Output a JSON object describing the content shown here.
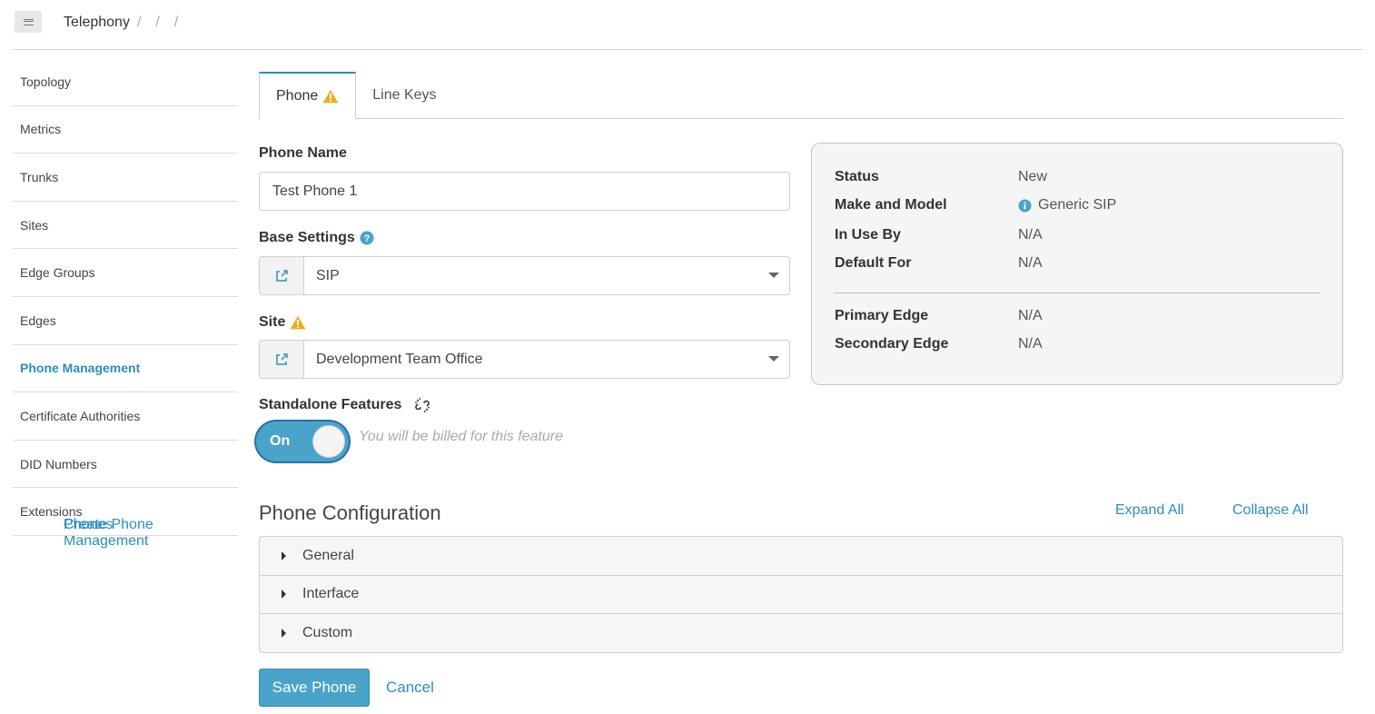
{
  "breadcrumb": {
    "items": [
      "Telephony",
      "Phone Management",
      "Phones",
      "Create Phone"
    ],
    "separator": "/"
  },
  "sidebar": {
    "items": [
      {
        "label": "Topology"
      },
      {
        "label": "Metrics"
      },
      {
        "label": "Trunks"
      },
      {
        "label": "Sites"
      },
      {
        "label": "Edge Groups"
      },
      {
        "label": "Edges"
      },
      {
        "label": "Phone Management",
        "active": true
      },
      {
        "label": "Certificate Authorities"
      },
      {
        "label": "DID Numbers"
      },
      {
        "label": "Extensions"
      }
    ]
  },
  "tabs": [
    {
      "label": "Phone",
      "active": true,
      "icon": "warning-icon"
    },
    {
      "label": "Line Keys"
    }
  ],
  "form": {
    "phone_name_label": "Phone Name",
    "phone_name_value": "Test Phone 1",
    "base_settings_label": "Base Settings",
    "base_settings_value": "SIP",
    "site_label": "Site",
    "site_value": "Development Team Office",
    "standalone_label": "Standalone Features",
    "toggle_label": "On",
    "billing_note": "You will be billed for this feature"
  },
  "info_panel": {
    "rows": [
      {
        "key": "Status",
        "value": "New"
      },
      {
        "key": "Make and Model",
        "value": "Generic SIP",
        "icon": "info-icon"
      },
      {
        "key": "In Use By",
        "value": "N/A"
      },
      {
        "key": "Default For",
        "value": "N/A"
      },
      {
        "key": "Primary Edge",
        "value": "N/A"
      },
      {
        "key": "Secondary Edge",
        "value": "N/A"
      }
    ]
  },
  "config": {
    "title": "Phone Configuration",
    "expand_all": "Expand All",
    "collapse_all": "Collapse All",
    "sections": [
      "General",
      "Interface",
      "Custom"
    ]
  },
  "actions": {
    "save_label": "Save Phone",
    "cancel_label": "Cancel"
  },
  "colors": {
    "accent": "#2a8fbd",
    "warning": "#f0ad1e",
    "toggle_bg": "#4aa3c9"
  }
}
